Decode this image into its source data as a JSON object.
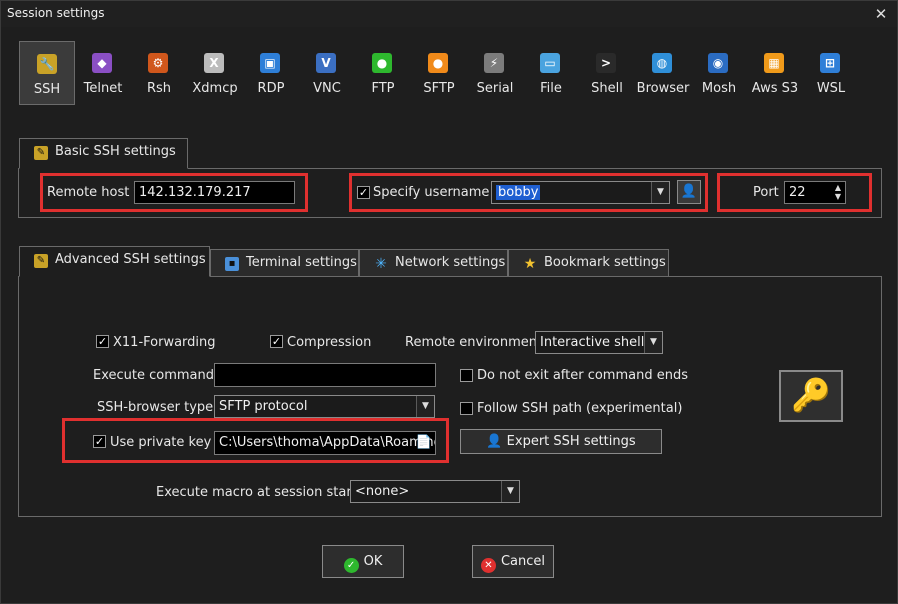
{
  "window": {
    "title": "Session settings"
  },
  "icons": {
    "close": "close-icon"
  },
  "protocols": [
    {
      "label": "SSH",
      "icon": "🔧",
      "color": "#c9a227",
      "selected": true
    },
    {
      "label": "Telnet",
      "icon": "◆",
      "color": "#8a4fc4"
    },
    {
      "label": "Rsh",
      "icon": "⚙",
      "color": "#d0571c"
    },
    {
      "label": "Xdmcp",
      "icon": "X",
      "color": "#bcbcbc"
    },
    {
      "label": "RDP",
      "icon": "▣",
      "color": "#2e7fd8"
    },
    {
      "label": "VNC",
      "icon": "V",
      "color": "#3b6fc2"
    },
    {
      "label": "FTP",
      "icon": "●",
      "color": "#2eb82e"
    },
    {
      "label": "SFTP",
      "icon": "●",
      "color": "#f08a1a"
    },
    {
      "label": "Serial",
      "icon": "⚡",
      "color": "#7c7c7c"
    },
    {
      "label": "File",
      "icon": "▭",
      "color": "#4aa3df"
    },
    {
      "label": "Shell",
      "icon": ">",
      "color": "#2a2a2a"
    },
    {
      "label": "Browser",
      "icon": "◍",
      "color": "#2f8fd8"
    },
    {
      "label": "Mosh",
      "icon": "◉",
      "color": "#2b6cc2"
    },
    {
      "label": "Aws S3",
      "icon": "▦",
      "color": "#f09a1a"
    },
    {
      "label": "WSL",
      "icon": "⊞",
      "color": "#2f7fd8"
    }
  ],
  "basic": {
    "tab_label": "Basic SSH settings",
    "remote_host_label": "Remote host *",
    "remote_host_value": "142.132.179.217",
    "specify_username_label": "Specify username",
    "username_value": "bobby",
    "port_label": "Port",
    "port_value": "22"
  },
  "tabs": [
    {
      "label": "Advanced SSH settings",
      "icon": "wrench-icon",
      "active": true
    },
    {
      "label": "Terminal settings",
      "icon": "terminal-icon"
    },
    {
      "label": "Network settings",
      "icon": "network-icon"
    },
    {
      "label": "Bookmark settings",
      "icon": "star-icon"
    }
  ],
  "advanced": {
    "x11_label": "X11-Forwarding",
    "compression_label": "Compression",
    "remote_env_label": "Remote environment:",
    "remote_env_value": "Interactive shell",
    "execute_command_label": "Execute command:",
    "execute_command_value": "",
    "do_not_exit_label": "Do not exit after command ends",
    "ssh_browser_label": "SSH-browser type:",
    "ssh_browser_value": "SFTP protocol",
    "follow_ssh_label": "Follow SSH path (experimental)",
    "use_private_key_label": "Use private key",
    "private_key_value": "C:\\Users\\thoma\\AppData\\Roaming",
    "expert_button": "Expert SSH settings",
    "macro_label": "Execute macro at session start:",
    "macro_value": "<none>"
  },
  "buttons": {
    "ok": "OK",
    "cancel": "Cancel"
  },
  "colors": {
    "highlight_red": "#e0302f",
    "selection_blue": "#1f5fd1"
  }
}
